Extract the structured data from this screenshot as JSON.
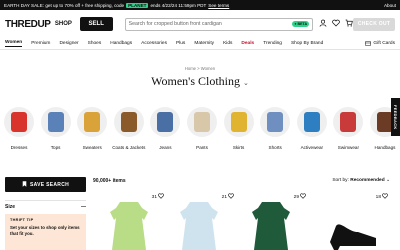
{
  "promo": {
    "text_before": "EARTH DAY SALE: get up to 70% off + free shipping, code",
    "code": "PLANET",
    "text_after": "ends 4/22/24 11:59pm PDT",
    "terms": "See terms",
    "about": "About"
  },
  "header": {
    "logo": "THREDUP",
    "shop": "SHOP",
    "sell": "SELL",
    "search_placeholder": "Search for cropped button front cardigan",
    "beta": "● BETA",
    "checkout": "CHECK OUT"
  },
  "nav": {
    "items": [
      "Women",
      "Premium",
      "Designer",
      "Shoes",
      "Handbags",
      "Accessories",
      "Plus",
      "Maternity",
      "Kids",
      "Deals",
      "Trending",
      "Shop By Brand"
    ],
    "gift_cards": "Gift Cards"
  },
  "breadcrumb": "Home > Women",
  "page_title": "Women's Clothing",
  "categories": [
    {
      "label": "Dresses",
      "color": "#d9342b"
    },
    {
      "label": "Tops",
      "color": "#5b82b8"
    },
    {
      "label": "Sweaters",
      "color": "#d9a33a"
    },
    {
      "label": "Coats & Jackets",
      "color": "#8a5a2b"
    },
    {
      "label": "Jeans",
      "color": "#4a6fa5"
    },
    {
      "label": "Pants",
      "color": "#d8c7a8"
    },
    {
      "label": "Skirts",
      "color": "#e0b431"
    },
    {
      "label": "Shorts",
      "color": "#6e8fbf"
    },
    {
      "label": "Activewear",
      "color": "#2d7fc1"
    },
    {
      "label": "Swimwear",
      "color": "#c93b3b"
    },
    {
      "label": "Handbags",
      "color": "#6b3b26"
    }
  ],
  "feedback": "FEEDBACK",
  "sidebar": {
    "save_search": "SAVE SEARCH",
    "size_label": "Size",
    "size_toggle": "—",
    "tip_title": "THRIFT TIP",
    "tip_text": "Set your sizes to shop only items that fit you."
  },
  "results": {
    "count": "90,000+ items",
    "sort_label": "Sort by:",
    "sort_value": "Recommended"
  },
  "products": [
    {
      "fav_count": "31",
      "color": "#b9dc86"
    },
    {
      "fav_count": "21",
      "color": "#cfe3ef"
    },
    {
      "fav_count": "29",
      "color": "#1f5a3a"
    },
    {
      "fav_count": "18",
      "color": "#111111"
    }
  ]
}
